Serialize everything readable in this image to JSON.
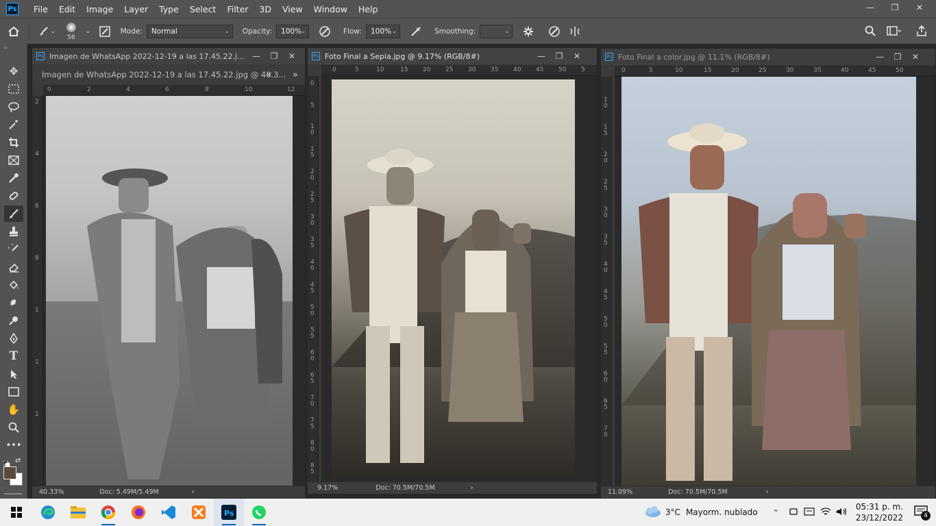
{
  "app": {
    "logo": "Ps"
  },
  "menu": [
    "File",
    "Edit",
    "Image",
    "Layer",
    "Type",
    "Select",
    "Filter",
    "3D",
    "View",
    "Window",
    "Help"
  ],
  "window_controls": {
    "minimize": "—",
    "restore": "❐",
    "close": "✕"
  },
  "options": {
    "brush_size": "58",
    "mode_label": "Mode:",
    "mode_value": "Normal",
    "opacity_label": "Opacity:",
    "opacity_value": "100%",
    "flow_label": "Flow:",
    "flow_value": "100%",
    "smoothing_label": "Smoothing:",
    "smoothing_value": ""
  },
  "tools": [
    "move-tool",
    "marquee-tool",
    "lasso-tool",
    "magic-wand-tool",
    "crop-tool",
    "frame-tool",
    "eyedropper-tool",
    "healing-brush-tool",
    "brush-tool",
    "clone-stamp-tool",
    "history-brush-tool",
    "eraser-tool",
    "paint-bucket-tool",
    "blur-tool",
    "dodge-tool",
    "pen-tool",
    "type-tool",
    "path-selection-tool",
    "rectangle-tool",
    "hand-tool",
    "zoom-tool",
    "more-tools"
  ],
  "documents": [
    {
      "title": "Imagen de WhatsApp 2022-12-19 a las 17.45.22.j...",
      "tab": "Imagen de WhatsApp 2022-12-19 a las 17.45.22.jpg @ 40.3...",
      "ruler_h": [
        "0",
        "2",
        "4",
        "6",
        "8",
        "10",
        "12"
      ],
      "ruler_v": [
        "2",
        "4",
        "6",
        "8",
        "1",
        "1",
        "1"
      ],
      "zoom": "40.33%",
      "doc": "Doc: 5.49M/5.49M"
    },
    {
      "title": "Foto Final a Sepia.jpg @ 9.17% (RGB/8#)",
      "ruler_h": [
        "0",
        "5",
        "10",
        "15",
        "20",
        "25",
        "30",
        "35",
        "40",
        "45",
        "50",
        "5"
      ],
      "ruler_v": [
        "0",
        "5",
        "1 0",
        "1 5",
        "2 0",
        "2 5",
        "3 0",
        "3 5",
        "4 0",
        "4 5",
        "5 0",
        "5 5",
        "6 0",
        "6 5",
        "7 0",
        "7 5",
        "8 0",
        "8 5"
      ],
      "zoom": "9.17%",
      "doc": "Doc: 70.5M/70.5M"
    },
    {
      "title": "Foto Final a color.jpg @ 11.1% (RGB/8#)",
      "ruler_h": [
        "0",
        "5",
        "10",
        "15",
        "20",
        "25",
        "30",
        "35",
        "40",
        "45",
        "50"
      ],
      "ruler_v": [
        "1 0",
        "1 5",
        "2 0",
        "2 5",
        "3 0",
        "3 5",
        "4 0",
        "4 5",
        "5 0",
        "5 5",
        "6 0",
        "6 5",
        "7 0"
      ],
      "zoom": "11.09%",
      "doc": "Doc: 70.5M/70.5M"
    }
  ],
  "taskbar": {
    "weather_temp": "3°C",
    "weather_text": "Mayorm. nublado",
    "time": "05:31 p. m.",
    "date": "23/12/2022",
    "notifications": "4"
  }
}
